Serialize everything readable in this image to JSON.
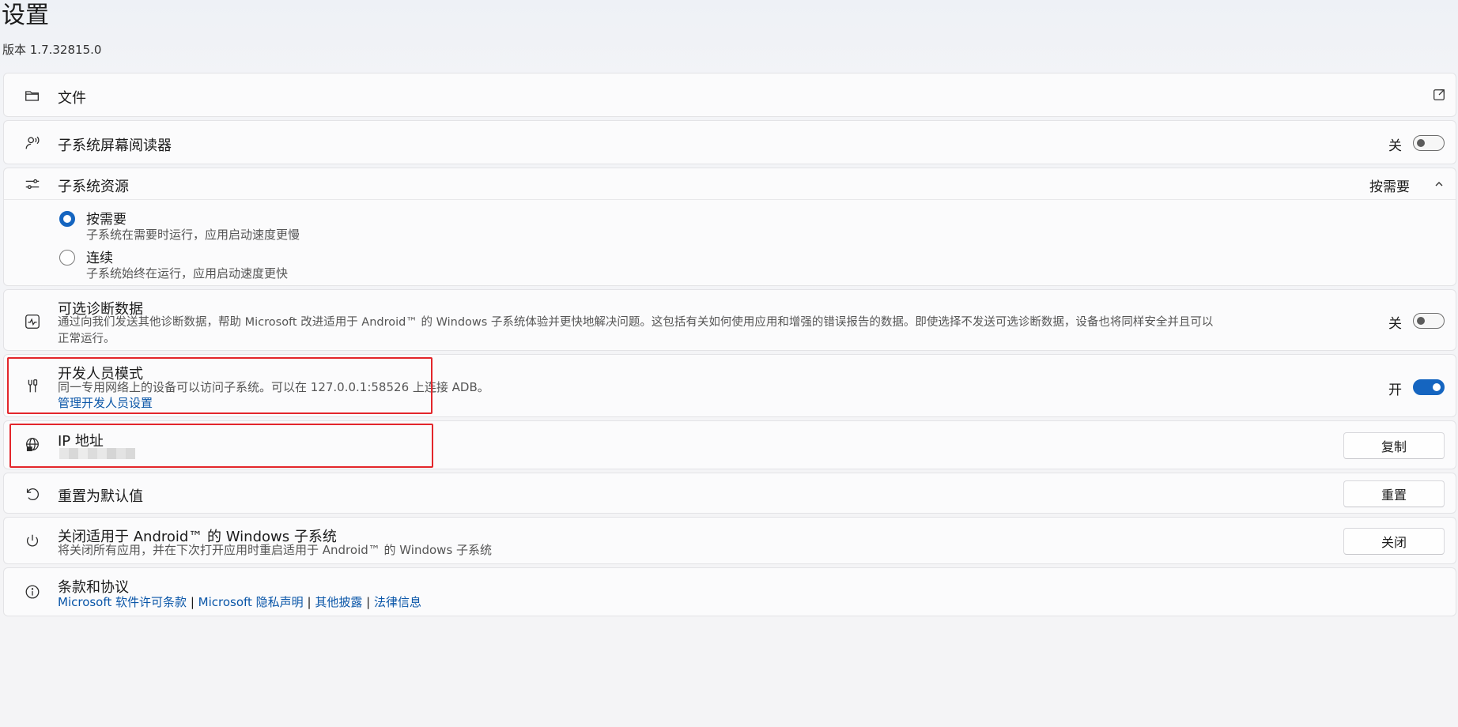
{
  "header": {
    "title": "设置",
    "version": "版本 1.7.32815.0"
  },
  "files": {
    "label": "文件",
    "icon": "folder-icon",
    "action_icon": "open-external-icon"
  },
  "screen_reader": {
    "label": "子系统屏幕阅读器",
    "icon": "narrator-icon",
    "toggle_label": "关",
    "toggle_on": false
  },
  "resources": {
    "label": "子系统资源",
    "icon": "sliders-icon",
    "selected_value": "按需要",
    "expanded": true,
    "options": [
      {
        "title": "按需要",
        "desc": "子系统在需要时运行，应用启动速度更慢",
        "checked": true
      },
      {
        "title": "连续",
        "desc": "子系统始终在运行，应用启动速度更快",
        "checked": false
      }
    ]
  },
  "diagnostics": {
    "label": "可选诊断数据",
    "icon": "activity-icon",
    "desc_line1": "通过向我们发送其他诊断数据，帮助 Microsoft 改进适用于 Android™ 的 Windows 子系统体验并更快地解决问题。这包括有关如何使用应用和增强的错误报告的数据。即使选择不发送可选诊断数据，设备也将同样安全并且可以",
    "desc_line2": "正常运行。",
    "toggle_label": "关",
    "toggle_on": false
  },
  "developer": {
    "label": "开发人员模式",
    "icon": "tools-icon",
    "desc": "同一专用网络上的设备可以访问子系统。可以在 127.0.0.1:58526 上连接 ADB。",
    "link": "管理开发人员设置",
    "toggle_label": "开",
    "toggle_on": true
  },
  "ip": {
    "label": "IP 地址",
    "icon": "globe-network-icon",
    "button": "复制"
  },
  "reset": {
    "label": "重置为默认值",
    "icon": "reset-icon",
    "button": "重置"
  },
  "shutdown": {
    "label": "关闭适用于 Android™ 的 Windows 子系统",
    "icon": "power-icon",
    "desc": "将关闭所有应用，并在下次打开应用时重启适用于 Android™ 的 Windows 子系统",
    "button": "关闭"
  },
  "terms": {
    "label": "条款和协议",
    "icon": "info-icon",
    "links": [
      "Microsoft 软件许可条款",
      "Microsoft 隐私声明",
      "其他披露",
      "法律信息"
    ],
    "separator": "|"
  },
  "colors": {
    "accent": "#1565c0",
    "link": "#0a56a8",
    "highlight": "#e3262b"
  }
}
